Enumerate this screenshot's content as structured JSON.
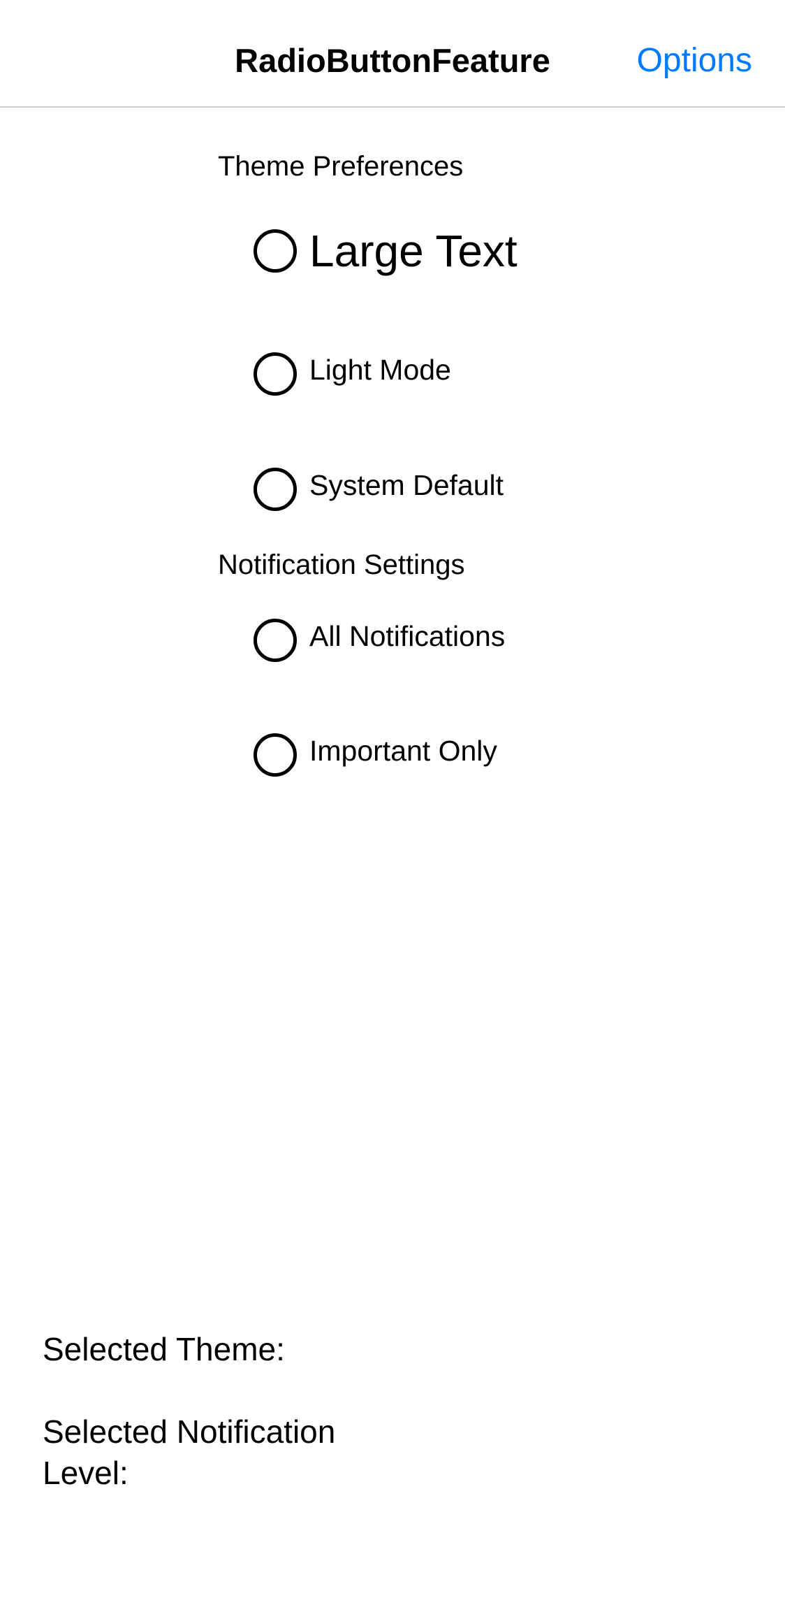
{
  "nav": {
    "title": "RadioButtonFeature",
    "options_label": "Options",
    "accent": "#007AFF"
  },
  "sections": [
    {
      "title": "Theme Preferences",
      "options": [
        {
          "label": "Large Text",
          "selected": false
        },
        {
          "label": "Light Mode",
          "selected": false
        },
        {
          "label": "System Default",
          "selected": false
        }
      ]
    },
    {
      "title": "Notification Settings",
      "options": [
        {
          "label": "All Notifications",
          "selected": false
        },
        {
          "label": "Important Only",
          "selected": false
        }
      ]
    }
  ],
  "summary": {
    "theme_label": "Selected Theme:",
    "notification_label": "Selected Notification Level:"
  }
}
